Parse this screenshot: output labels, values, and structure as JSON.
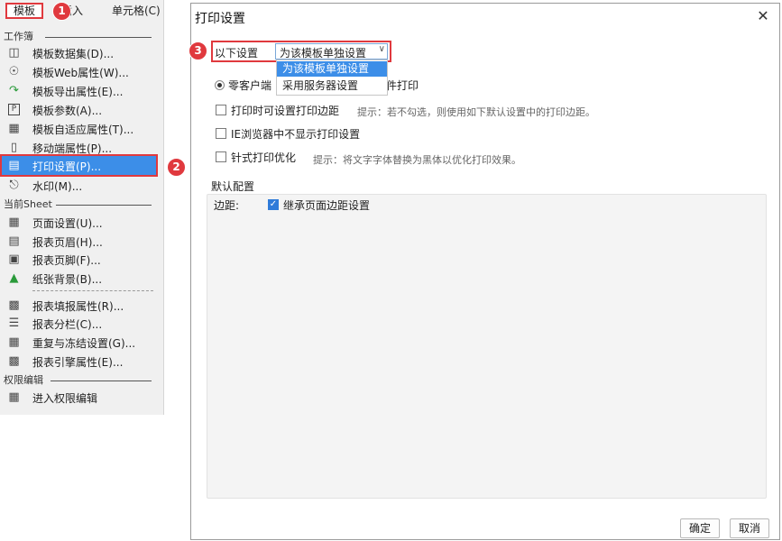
{
  "menubar": {
    "tabs": [
      "模板",
      "插入",
      "单元格(C)"
    ]
  },
  "badges": [
    "1",
    "2",
    "3"
  ],
  "menu": {
    "sections": {
      "workbook": "工作簿",
      "current_sheet": "当前Sheet",
      "permission": "权限编辑"
    },
    "items": [
      {
        "label": "模板数据集(D)...",
        "icon": "database-icon"
      },
      {
        "label": "模板Web属性(W)...",
        "icon": "globe-icon"
      },
      {
        "label": "模板导出属性(E)...",
        "icon": "export-icon"
      },
      {
        "label": "模板参数(A)...",
        "icon": "parameter-icon"
      },
      {
        "label": "模板自适应属性(T)...",
        "icon": "adaptive-icon"
      },
      {
        "label": "移动端属性(P)...",
        "icon": "mobile-icon"
      },
      {
        "label": "打印设置(P)...",
        "icon": "printer-icon"
      },
      {
        "label": "水印(M)...",
        "icon": "watermark-icon"
      },
      {
        "label": "页面设置(U)...",
        "icon": "page-setup-icon"
      },
      {
        "label": "报表页眉(H)...",
        "icon": "header-icon"
      },
      {
        "label": "报表页脚(F)...",
        "icon": "footer-icon"
      },
      {
        "label": "纸张背景(B)...",
        "icon": "background-image-icon"
      },
      {
        "label": "报表填报属性(R)...",
        "icon": "form-icon"
      },
      {
        "label": "报表分栏(C)...",
        "icon": "columns-icon"
      },
      {
        "label": "重复与冻结设置(G)...",
        "icon": "freeze-icon"
      },
      {
        "label": "报表引擎属性(E)...",
        "icon": "engine-icon"
      },
      {
        "label": "进入权限编辑",
        "icon": "permission-icon"
      }
    ]
  },
  "dialog": {
    "title": "打印设置",
    "settings_label": "以下设置",
    "combo_value": "为该模板单独设置",
    "dropdown_options": [
      "为该模板单独设置",
      "采用服务器设置"
    ],
    "radio_label_left": "零客户端",
    "radio_label_right": "件打印",
    "options": [
      {
        "label": "打印时可设置打印边距",
        "checked": false
      },
      {
        "label": "IE浏览器中不显示打印设置",
        "checked": false
      },
      {
        "label": "针式打印优化",
        "checked": false
      }
    ],
    "hint_margin": "提示：若不勾选，则使用如下默认设置中的打印边距。",
    "hint_dot": "提示：将文字字体替换为黑体以优化打印效果。",
    "default_config_title": "默认配置",
    "margin_label": "边距:",
    "inherit_label": "继承页面边距设置",
    "inherit_checked": true,
    "ok_label": "确定",
    "cancel_label": "取消"
  },
  "colors": {
    "highlight": "#3c8ee8",
    "annotation_red": "#e0393e"
  }
}
